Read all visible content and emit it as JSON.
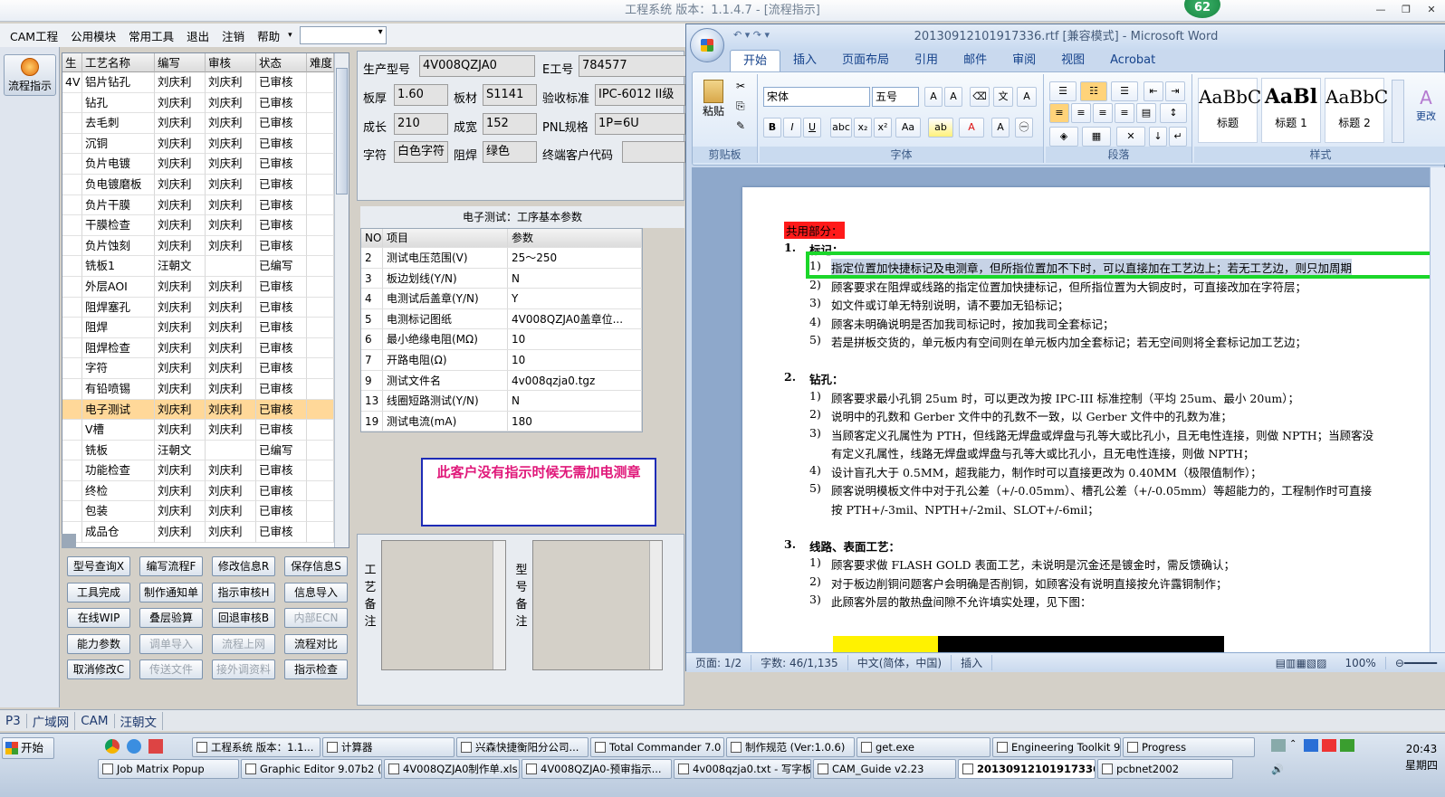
{
  "main_title": "工程系统  版本：1.1.4.7 - [流程指示]",
  "badge_count": "62",
  "menu": [
    "CAM工程",
    "公用模块",
    "常用工具",
    "退出",
    "注销",
    "帮助"
  ],
  "flow_button": "流程指示",
  "proc_headers": [
    "生",
    "工艺名称",
    "编写",
    "审核",
    "状态",
    "难度"
  ],
  "proc_first_col": "4V",
  "proc_rows": [
    [
      "铝片钻孔",
      "刘庆利",
      "刘庆利",
      "已审核"
    ],
    [
      "钻孔",
      "刘庆利",
      "刘庆利",
      "已审核"
    ],
    [
      "去毛刺",
      "刘庆利",
      "刘庆利",
      "已审核"
    ],
    [
      "沉铜",
      "刘庆利",
      "刘庆利",
      "已审核"
    ],
    [
      "负片电镀",
      "刘庆利",
      "刘庆利",
      "已审核"
    ],
    [
      "负电镀磨板",
      "刘庆利",
      "刘庆利",
      "已审核"
    ],
    [
      "负片干膜",
      "刘庆利",
      "刘庆利",
      "已审核"
    ],
    [
      "干膜检查",
      "刘庆利",
      "刘庆利",
      "已审核"
    ],
    [
      "负片蚀刻",
      "刘庆利",
      "刘庆利",
      "已审核"
    ],
    [
      "铣板1",
      "汪朝文",
      "",
      "已编写"
    ],
    [
      "外层AOI",
      "刘庆利",
      "刘庆利",
      "已审核"
    ],
    [
      "阻焊塞孔",
      "刘庆利",
      "刘庆利",
      "已审核"
    ],
    [
      "阻焊",
      "刘庆利",
      "刘庆利",
      "已审核"
    ],
    [
      "阻焊检查",
      "刘庆利",
      "刘庆利",
      "已审核"
    ],
    [
      "字符",
      "刘庆利",
      "刘庆利",
      "已审核"
    ],
    [
      "有铅喷锡",
      "刘庆利",
      "刘庆利",
      "已审核"
    ],
    [
      "电子测试",
      "刘庆利",
      "刘庆利",
      "已审核"
    ],
    [
      "V槽",
      "刘庆利",
      "刘庆利",
      "已审核"
    ],
    [
      "铣板",
      "汪朝文",
      "",
      "已编写"
    ],
    [
      "功能检查",
      "刘庆利",
      "刘庆利",
      "已审核"
    ],
    [
      "终检",
      "刘庆利",
      "刘庆利",
      "已审核"
    ],
    [
      "包装",
      "刘庆利",
      "刘庆利",
      "已审核"
    ],
    [
      "成品仓",
      "刘庆利",
      "刘庆利",
      "已审核"
    ]
  ],
  "buttons": [
    [
      "型号查询X",
      "编写流程F",
      "修改信息R",
      "保存信息S"
    ],
    [
      "工具完成",
      "制作通知单",
      "指示审核H",
      "信息导入"
    ],
    [
      "在线WIP",
      "叠层验算",
      "回退审核B",
      "内部ECN"
    ],
    [
      "能力参数",
      "调单导入",
      "流程上网",
      "流程对比"
    ],
    [
      "取消修改C",
      "传送文件",
      "接外调资料",
      "指示检查"
    ]
  ],
  "disabled_buttons": [
    "内部ECN",
    "调单导入",
    "流程上网",
    "传送文件",
    "接外调资料"
  ],
  "info": {
    "model_label": "生产型号",
    "model": "4V008QZJA0",
    "eno_label": "E工号",
    "eno": "784577",
    "thick_label": "板厚",
    "thick": "1.60",
    "material_label": "板材",
    "material": "S1141",
    "std_label": "验收标准",
    "std": "IPC-6012 II级",
    "len_label": "成长",
    "len": "210",
    "wid_label": "成宽",
    "wid": "152",
    "pnl_label": "PNL规格",
    "pnl": "1P=6U",
    "char_label": "字符",
    "char": "白色字符",
    "mask_label": "阻焊",
    "mask": "绿色",
    "cust_label": "终端客户代码",
    "cust": ""
  },
  "param_title": "电子测试：工序基本参数",
  "param_headers": [
    "NO",
    "项目",
    "参数"
  ],
  "params": [
    [
      "2",
      "测试电压范围(V)",
      "25～250"
    ],
    [
      "3",
      "板边划线(Y/N)",
      "N"
    ],
    [
      "4",
      "电测试后盖章(Y/N)",
      "Y"
    ],
    [
      "5",
      "电测标记图纸",
      "4V008QZJA0盖章位..."
    ],
    [
      "6",
      "最小绝缘电阻(MΩ)",
      "10"
    ],
    [
      "7",
      "开路电阻(Ω)",
      "10"
    ],
    [
      "9",
      "测试文件名",
      "4v008qzja0.tgz"
    ],
    [
      "13",
      "线圈短路测试(Y/N)",
      "N"
    ],
    [
      "19",
      "测试电流(mA)",
      "180"
    ]
  ],
  "note_text": "此客户没有指示时候无需加电测章",
  "remark_proc_label": "工艺备注",
  "remark_model_label": "型号备注",
  "status_items": [
    "P3",
    "广域网",
    "CAM",
    "汪朝文"
  ],
  "word": {
    "title": "20130912101917336.rtf [兼容模式] - Microsoft Word",
    "tabs": [
      "开始",
      "插入",
      "页面布局",
      "引用",
      "邮件",
      "审阅",
      "视图",
      "Acrobat"
    ],
    "paste_label": "粘贴",
    "font": "宋体",
    "size": "五号",
    "group_labels": [
      "剪贴板",
      "字体",
      "段落",
      "样式"
    ],
    "styles": [
      {
        "sample": "AaBbC",
        "name": "标题"
      },
      {
        "sample": "AaBl",
        "name": "标题 1"
      },
      {
        "sample": "AaBbC",
        "name": "标题 2"
      }
    ],
    "more_label": "更改",
    "doc_heading": "共用部分：",
    "sections": [
      {
        "num": "1.",
        "title": "标记：",
        "items": [
          "指定位置加快捷标记及电测章，但所指位置加不下时，可以直接加在工艺边上；若无工艺边，则只加周期",
          "顾客要求在阻焊或线路的指定位置加快捷标记，但所指位置为大铜皮时，可直接改加在字符层；",
          "如文件或订单无特别说明，请不要加无铅标记；",
          "顾客未明确说明是否加我司标记时，按加我司全套标记；",
          "若是拼板交货的，单元板内有空间则在单元板内加全套标记；若无空间则将全套标记加工艺边；"
        ]
      },
      {
        "num": "2.",
        "title": "钻孔：",
        "items": [
          "顾客要求最小孔铜 25um 时，可以更改为按 IPC-III 标准控制（平均 25um、最小 20um）；",
          "说明中的孔数和 Gerber 文件中的孔数不一致，以 Gerber 文件中的孔数为准；",
          "当顾客定义孔属性为 PTH，但线路无焊盘或焊盘与孔等大或比孔小，且无电性连接，则做 NPTH；当顾客没",
          "有定义孔属性，线路无焊盘或焊盘与孔等大或比孔小，且无电性连接，则做 NPTH；",
          "设计盲孔大于 0.5MM，超我能力，制作时可以直接更改为 0.40MM（极限值制作）；",
          "顾客说明模板文件中对于孔公差（+/-0.05mm）、槽孔公差（+/-0.05mm）等超能力的，工程制作时可直接",
          "按 PTH+/-3mil、NPTH+/-2mil、SLOT+/-6mil；"
        ]
      },
      {
        "num": "3.",
        "title": "线路、表面工艺：",
        "items": [
          "顾客要求做 FLASH GOLD 表面工艺，未说明是沉金还是镀金时，需反馈确认；",
          "对于板边削铜问题客户会明确是否削铜，如顾客没有说明直接按允许露铜制作；",
          "此顾客外层的散热盘间隙不允许填实处理，见下图："
        ]
      }
    ],
    "item_nums": [
      "1)",
      "2)",
      "3)",
      "4)",
      "5)"
    ],
    "status": [
      "页面: 1/2",
      "字数: 46/1,135",
      "中文(简体，中国)",
      "插入",
      "100%"
    ]
  },
  "taskbar": {
    "start": "开始",
    "row1": [
      "工程系统  版本：1.1...",
      "计算器",
      "兴森快捷衡阳分公司...",
      "Total Commander 7.0 ...",
      "制作规范 (Ver:1.0.6)",
      "get.exe",
      "Engineering Toolkit 9....",
      "Progress"
    ],
    "row2": [
      "Job Matrix Popup",
      "Graphic Editor 9.07b2 (0...",
      "4V008QZJA0制作单.xls ...",
      "4V008QZJA0-预审指示...",
      "4v008qzja0.txt - 写字板",
      "CAM_Guide v2.23",
      "20130912101917336....",
      "pcbnet2002"
    ],
    "time": "20:43",
    "weekday": "星期四"
  }
}
